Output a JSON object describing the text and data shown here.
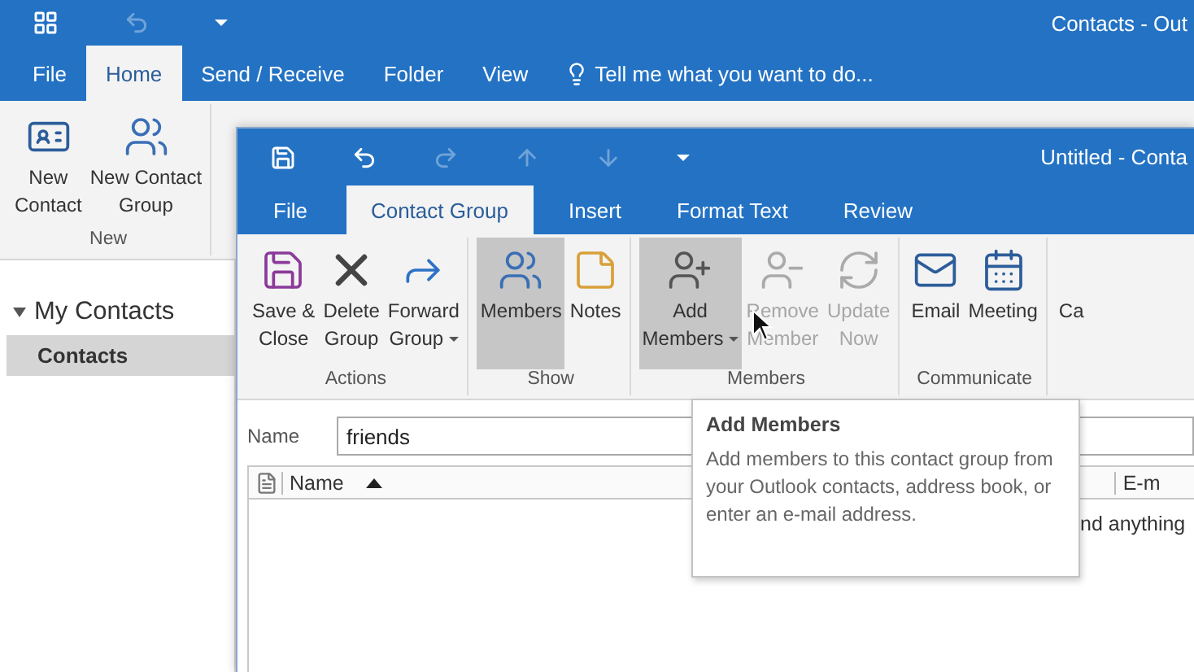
{
  "main_window": {
    "title": "Contacts - Out",
    "quick_access": [
      {
        "kind": "app"
      },
      {
        "kind": "undo",
        "disabled": true
      },
      {
        "kind": "customize"
      }
    ],
    "tabs": [
      {
        "label": "File",
        "selected": false
      },
      {
        "label": "Home",
        "selected": true
      },
      {
        "label": "Send / Receive",
        "selected": false
      },
      {
        "label": "Folder",
        "selected": false
      },
      {
        "label": "View",
        "selected": false
      }
    ],
    "tell_me": "Tell me what you want to do...",
    "new_group": {
      "label": "New",
      "buttons": [
        {
          "kind": "contact",
          "label": "New\nContact"
        },
        {
          "kind": "group",
          "label": "New Contact\nGroup"
        }
      ]
    },
    "navigation": {
      "folder": "My Contacts",
      "expanded": true,
      "items": [
        {
          "label": "Contacts",
          "selected": true
        }
      ]
    }
  },
  "group_window": {
    "title": "Untitled - Conta",
    "quick_access": [
      {
        "kind": "save",
        "disabled": false
      },
      {
        "kind": "undo",
        "disabled": false
      },
      {
        "kind": "redo",
        "disabled": true
      },
      {
        "kind": "up",
        "disabled": true
      },
      {
        "kind": "down",
        "disabled": true
      },
      {
        "kind": "customize",
        "disabled": false
      }
    ],
    "tabs": [
      {
        "label": "File",
        "selected": false
      },
      {
        "label": "Contact Group",
        "selected": true
      },
      {
        "label": "Insert",
        "selected": false
      },
      {
        "label": "Format Text",
        "selected": false
      },
      {
        "label": "Review",
        "selected": false
      }
    ],
    "ribbon_groups": [
      {
        "label": "Actions",
        "buttons": [
          {
            "kind": "save",
            "label": "Save &\nClose",
            "selected": false,
            "disabled": false,
            "dropdown": false
          },
          {
            "kind": "delete",
            "label": "Delete\nGroup",
            "selected": false,
            "disabled": false,
            "dropdown": false
          },
          {
            "kind": "forward",
            "label": "Forward\nGroup",
            "selected": false,
            "disabled": false,
            "dropdown": true
          }
        ]
      },
      {
        "label": "Show",
        "buttons": [
          {
            "kind": "members",
            "label": "Members",
            "selected": true,
            "disabled": false,
            "dropdown": false
          },
          {
            "kind": "notes",
            "label": "Notes",
            "selected": false,
            "disabled": false,
            "dropdown": false
          }
        ]
      },
      {
        "label": "Members",
        "buttons": [
          {
            "kind": "add",
            "label": "Add\nMembers",
            "selected": true,
            "disabled": false,
            "dropdown": true
          },
          {
            "kind": "remove",
            "label": "Remove\nMember",
            "selected": false,
            "disabled": true,
            "dropdown": false
          },
          {
            "kind": "update",
            "label": "Update\nNow",
            "selected": false,
            "disabled": true,
            "dropdown": false
          }
        ]
      },
      {
        "label": "Communicate",
        "buttons": [
          {
            "kind": "email",
            "label": "Email",
            "selected": false,
            "disabled": false,
            "dropdown": false
          },
          {
            "kind": "meeting",
            "label": "Meeting",
            "selected": false,
            "disabled": false,
            "dropdown": false
          }
        ]
      },
      {
        "buttons": [
          {
            "kind": "cut",
            "label": "Ca",
            "selected": false,
            "disabled": false,
            "dropdown": false
          }
        ]
      }
    ],
    "name_label": "Name",
    "name_value": "friends",
    "columns": [
      {
        "label": "Name",
        "sorted": true
      },
      {
        "label": "E-m",
        "sorted": false
      }
    ],
    "empty_text": "nd anything"
  },
  "tooltip": {
    "title": "Add Members",
    "text": "Add members to this contact group from your Outlook contacts, address book, or enter an e-mail address."
  }
}
